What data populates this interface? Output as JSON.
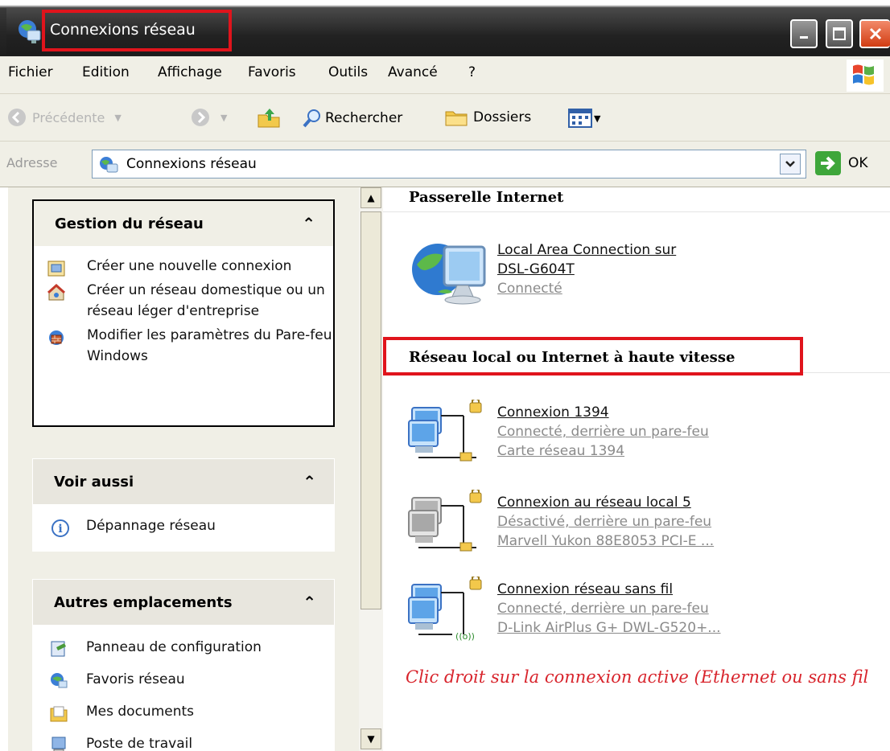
{
  "window": {
    "title": "Connexions réseau"
  },
  "menu": {
    "items": [
      "Fichier",
      "Edition",
      "Affichage",
      "Favoris",
      "Outils",
      "Avancé",
      "?"
    ]
  },
  "toolbar": {
    "back_label": "Précédente",
    "search_label": "Rechercher",
    "folders_label": "Dossiers"
  },
  "address": {
    "label": "Adresse",
    "value": "Connexions réseau",
    "go_label": "OK"
  },
  "sidebar": {
    "network_tasks": {
      "title": "Gestion du réseau",
      "items": [
        "Créer une nouvelle connexion",
        "Créer un réseau domestique ou un réseau léger d'entreprise",
        "Modifier les paramètres du Pare-feu Windows"
      ]
    },
    "see_also": {
      "title": "Voir aussi",
      "items": [
        "Dépannage réseau"
      ]
    },
    "other_places": {
      "title": "Autres emplacements",
      "items": [
        "Panneau de configuration",
        "Favoris réseau",
        "Mes documents",
        "Poste de travail"
      ]
    }
  },
  "content": {
    "gateway_section": {
      "title": "Passerelle Internet",
      "connections": [
        {
          "name_line1": "Local Area Connection sur ",
          "name_line2": "DSL-G604T",
          "status": "Connecté"
        }
      ]
    },
    "lan_section": {
      "title": "Réseau local ou Internet à haute vitesse",
      "connections": [
        {
          "name": "Connexion 1394",
          "status": "Connecté, derrière un pare-feu",
          "device": "Carte réseau 1394"
        },
        {
          "name": "Connexion au réseau local 5",
          "status": "Désactivé, derrière un pare-feu",
          "device": "Marvell Yukon 88E8053 PCI-E ..."
        },
        {
          "name": "Connexion réseau sans fil",
          "status": "Connecté, derrière un pare-feu",
          "device": "D-Link AirPlus G+ DWL-G520+..."
        }
      ]
    },
    "annotation": "Clic droit sur la connexion active (Ethernet ou sans fil"
  },
  "colors": {
    "highlight_red": "#e0141c",
    "annotation_red": "#d8242c",
    "panel_bg": "#f0efe6"
  }
}
